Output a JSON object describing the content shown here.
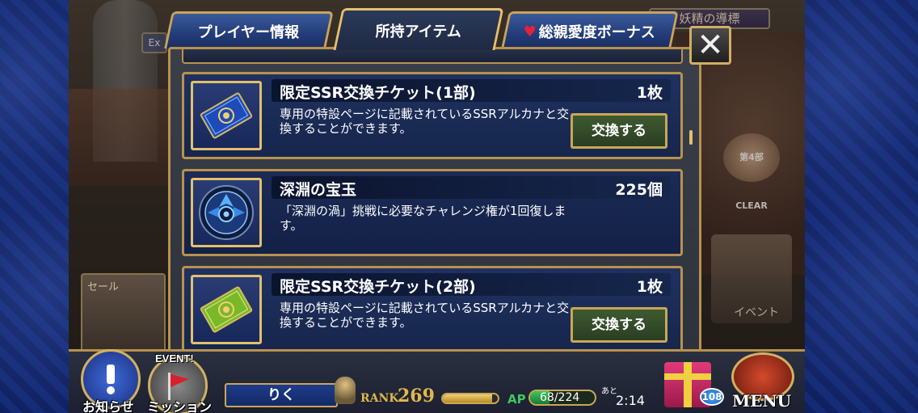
{
  "tabs": [
    {
      "label": "プレイヤー情報"
    },
    {
      "label": "所持アイテム"
    },
    {
      "label": "総親愛度ボーナス"
    }
  ],
  "close_label": "✕",
  "background": {
    "fairy_label": "妖精の導標",
    "sale_label": "セール",
    "clear_badge": "第4部 CLEAR",
    "event_label": "イベント",
    "left_stub": "Ex"
  },
  "items": [
    {
      "name": "限定SSR交換チケット(1部)",
      "count": "1枚",
      "description": "専用の特設ページに記載されているSSRアルカナと交換することができます。",
      "button": "交換する",
      "icon": "ticket-blue-icon"
    },
    {
      "name": "深淵の宝玉",
      "count": "225個",
      "description": "「深淵の渦」挑戦に必要なチャレンジ権が1回復します。",
      "icon": "abyss-orb-icon"
    },
    {
      "name": "限定SSR交換チケット(2部)",
      "count": "1枚",
      "description": "専用の特設ページに記載されているSSRアルカナと交換することができます。",
      "button": "交換する",
      "icon": "ticket-green-icon"
    }
  ],
  "bottom": {
    "news_label": "お知らせ",
    "mission_label": "ミッション",
    "event_badge": "EVENT!",
    "player_name": "りく",
    "rank_label": "RANK",
    "rank_value": "269",
    "rank_progress": 0.9,
    "ap_label": "AP",
    "ap_value": "68/224",
    "ap_progress": 0.3,
    "ap_time_prefix": "あと",
    "ap_time": "2:14",
    "gift_count": "108",
    "menu_label": "MENU"
  },
  "colors": {
    "gold_border": "#b7924f",
    "panel_bg": "#16264c",
    "button_green": "#2a3e22",
    "ap_green": "#3ec860"
  }
}
